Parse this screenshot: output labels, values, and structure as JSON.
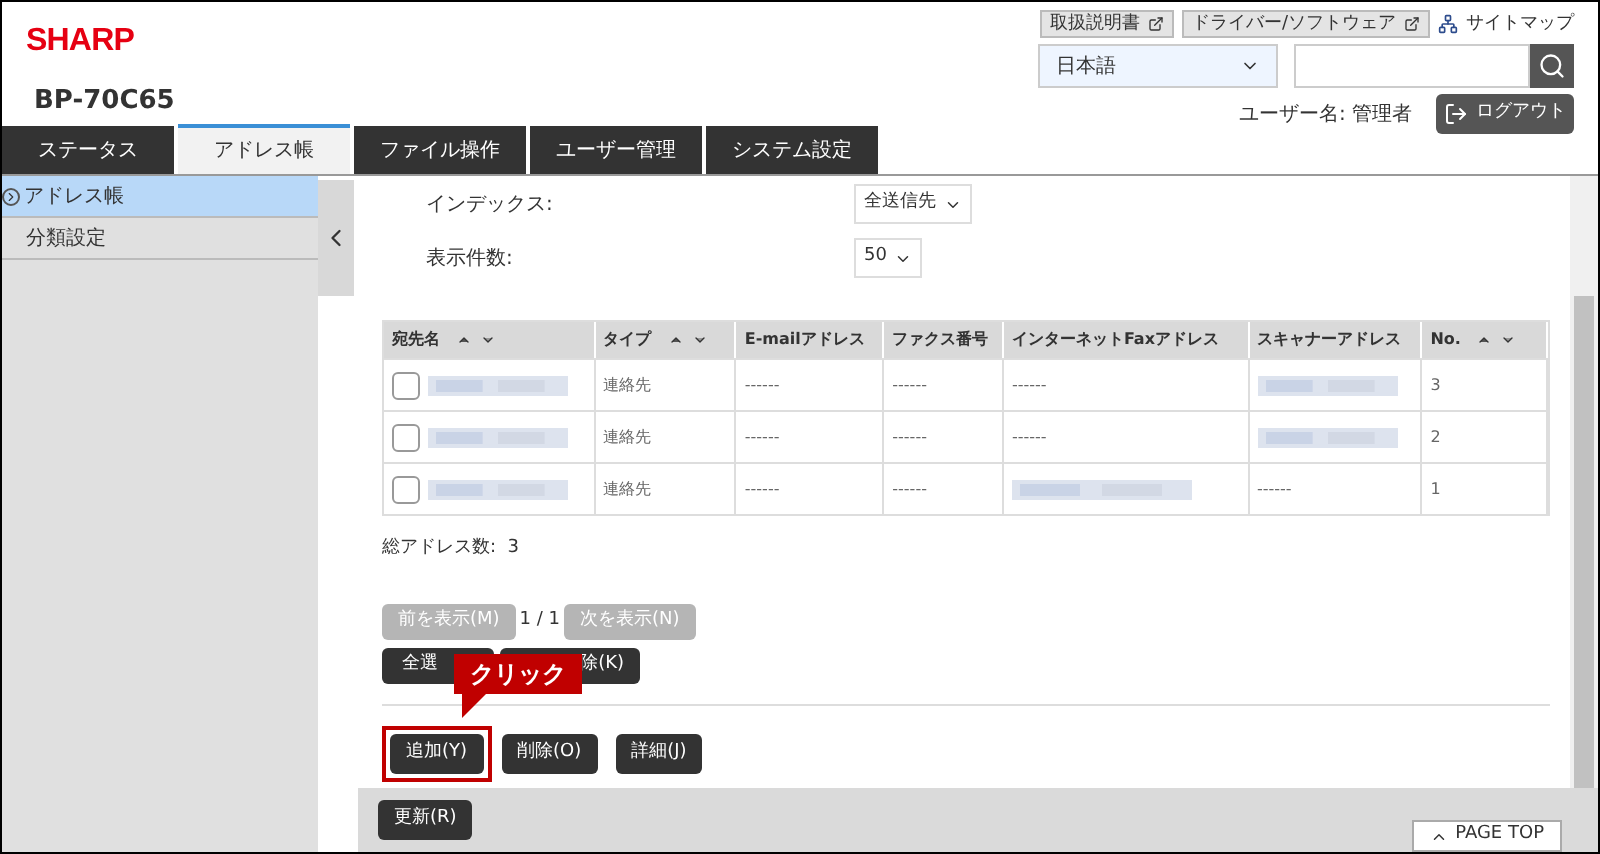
{
  "header": {
    "logo": "SHARP",
    "model": "BP-70C65",
    "links": [
      {
        "kind": "external",
        "label": "取扱説明書"
      },
      {
        "kind": "external",
        "label": "ドライバー/ソフトウェア"
      },
      {
        "kind": "sitemap",
        "label": "サイトマップ"
      }
    ],
    "language": "日本語",
    "user": "ユーザー名: 管理者",
    "logout": "ログアウト"
  },
  "tabs": [
    {
      "label": "ステータス",
      "selected": false
    },
    {
      "label": "アドレス帳",
      "selected": true
    },
    {
      "label": "ファイル操作",
      "selected": false
    },
    {
      "label": "ユーザー管理",
      "selected": false
    },
    {
      "label": "システム設定",
      "selected": false
    }
  ],
  "sidebar": {
    "items": [
      {
        "label": "アドレス帳",
        "selected": true
      },
      {
        "label": "分類設定",
        "selected": false
      }
    ]
  },
  "filters": [
    {
      "label": "インデックス:",
      "value": "全送信先"
    },
    {
      "label": "表示件数:",
      "value": "50"
    }
  ],
  "table": {
    "columns": [
      {
        "label": "宛先名",
        "sortable": true
      },
      {
        "label": "タイプ",
        "sortable": true
      },
      {
        "label": "E-mailアドレス",
        "sortable": false
      },
      {
        "label": "ファクス番号",
        "sortable": false
      },
      {
        "label": "インターネットFaxアドレス",
        "sortable": false
      },
      {
        "label": "スキャナーアドレス",
        "sortable": false
      },
      {
        "label": "No.",
        "sortable": true
      }
    ],
    "rows": [
      {
        "checked": false,
        "cells": [
          {
            "kind": "blurred"
          },
          {
            "kind": "text",
            "text": "連絡先"
          },
          {
            "kind": "text",
            "text": "------"
          },
          {
            "kind": "text",
            "text": "------"
          },
          {
            "kind": "text",
            "text": "------"
          },
          {
            "kind": "blurred"
          },
          {
            "kind": "text",
            "text": "3"
          }
        ]
      },
      {
        "checked": false,
        "cells": [
          {
            "kind": "blurred"
          },
          {
            "kind": "text",
            "text": "連絡先"
          },
          {
            "kind": "text",
            "text": "------"
          },
          {
            "kind": "text",
            "text": "------"
          },
          {
            "kind": "text",
            "text": "------"
          },
          {
            "kind": "blurred"
          },
          {
            "kind": "text",
            "text": "2"
          }
        ]
      },
      {
        "checked": false,
        "cells": [
          {
            "kind": "blurred"
          },
          {
            "kind": "text",
            "text": "連絡先"
          },
          {
            "kind": "text",
            "text": "------"
          },
          {
            "kind": "text",
            "text": "------"
          },
          {
            "kind": "blurred"
          },
          {
            "kind": "text",
            "text": "------"
          },
          {
            "kind": "text",
            "text": "1"
          }
        ]
      }
    ]
  },
  "total": "総アドレス数:  3",
  "pager": {
    "prev": {
      "label": "前を表示(M)",
      "disabled": true
    },
    "page": "1 / 1",
    "next": {
      "label": "次を表示(N)",
      "disabled": true
    }
  },
  "select_buttons": [
    "全選",
    "除(K)"
  ],
  "callout": "クリック",
  "actions": [
    {
      "label": "追加(Y)",
      "highlighted": true
    },
    {
      "label": "削除(O)",
      "highlighted": false
    },
    {
      "label": "詳細(J)",
      "highlighted": false
    }
  ],
  "refresh": "更新(R)",
  "page_top": "PAGE TOP"
}
